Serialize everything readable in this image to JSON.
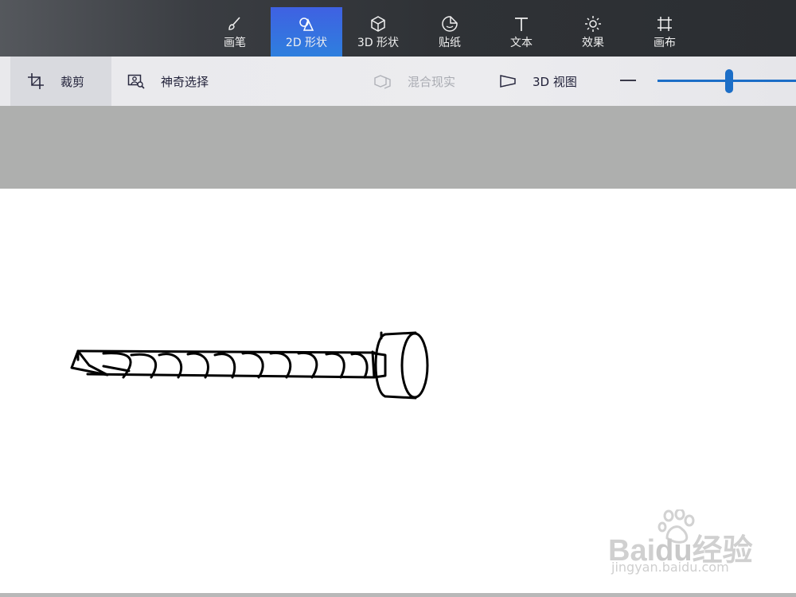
{
  "tabs": [
    {
      "label": "画笔",
      "icon": "brush-icon",
      "active": false
    },
    {
      "label": "2D 形状",
      "icon": "2d-shapes-icon",
      "active": true
    },
    {
      "label": "3D 形状",
      "icon": "3d-cube-icon",
      "active": false
    },
    {
      "label": "贴纸",
      "icon": "sticker-icon",
      "active": false
    },
    {
      "label": "文本",
      "icon": "text-icon",
      "active": false
    },
    {
      "label": "效果",
      "icon": "sun-effects-icon",
      "active": false
    },
    {
      "label": "画布",
      "icon": "canvas-icon",
      "active": false
    }
  ],
  "toolbar": {
    "crop_label": "裁剪",
    "magic_select_label": "神奇选择",
    "mixed_reality_label": "混合现实",
    "view3d_label": "3D 视图",
    "zoom_out_symbol": "—",
    "zoom_level": 0.52
  },
  "colors": {
    "accent": "#2f7fde",
    "active_tab": "#3f61e2",
    "slider": "#1c6ec7",
    "workspace": "#aeafae"
  },
  "watermark": {
    "brand_left": "Bai",
    "brand_mid": "du",
    "brand_right": "经验",
    "url": "jingyan.baidu.com"
  }
}
